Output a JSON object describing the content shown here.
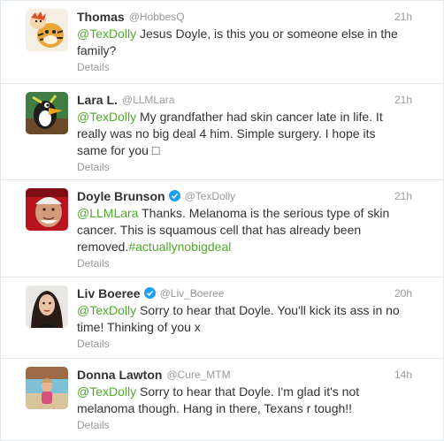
{
  "tweets": [
    {
      "name": "Thomas",
      "handle": "@HobbesQ",
      "time": "21h",
      "mention": "@TexDolly",
      "text": " Jesus Doyle, is this you or someone else in the family?",
      "details": "Details",
      "avatar_icon": "calvin-hobbes-avatar"
    },
    {
      "name": "Lara L.",
      "handle": "@LLMLara",
      "time": "21h",
      "mention": "@TexDolly",
      "text": " My grandfather had skin cancer late in life. It really was no big deal 4 him. Simple surgery. I hope its same for you □",
      "details": "Details",
      "avatar_icon": "cartoon-duck-avatar"
    },
    {
      "name": "Doyle Brunson",
      "handle": "@TexDolly",
      "time": "21h",
      "mention": "@LLMLara",
      "text": " Thanks. Melanoma is the serious type of skin cancer. This is squamous cell that has already been removed.",
      "hashtag": "#actuallynobigdeal",
      "details": "Details",
      "verified": true,
      "avatar_icon": "portrait-photo-avatar"
    },
    {
      "name": "Liv Boeree",
      "handle": "@Liv_Boeree",
      "time": "20h",
      "mention": "@TexDolly",
      "text": " Sorry to hear that Doyle. You'll kick its ass in no time! Thinking of you x",
      "details": "Details",
      "verified": true,
      "avatar_icon": "portrait-photo-avatar"
    },
    {
      "name": "Donna Lawton",
      "handle": "@Cure_MTM",
      "time": "14h",
      "mention": "@TexDolly",
      "text": " Sorry to hear that Doyle. I'm glad it's not melanoma though. Hang in there, Texans r tough!!",
      "details": "Details",
      "avatar_icon": "beach-photo-avatar"
    }
  ],
  "colors": {
    "link": "#50a82e",
    "name": "#333333",
    "meta": "#999999",
    "verified": "#1da1f2"
  }
}
